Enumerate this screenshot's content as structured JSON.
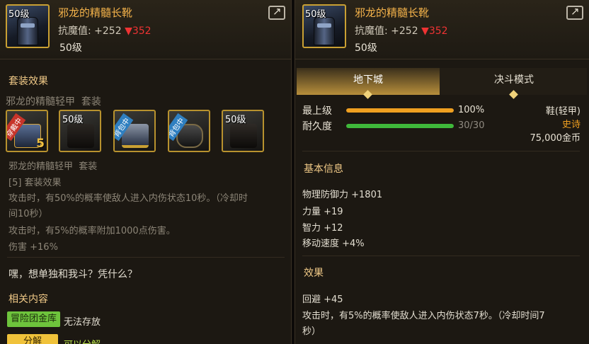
{
  "left": {
    "item": {
      "level_badge": "50级",
      "name": "邪龙的精髓长靴",
      "resist_label": "抗魔值: +252 ",
      "resist_down": "▼352",
      "level": "50级"
    },
    "set_effect_title": "套装效果",
    "set_name": "邪龙的精髓轻甲",
    "set_suffix": "套装",
    "slots": [
      {
        "tag": "穿戴中",
        "level": "",
        "num": "5"
      },
      {
        "tag": "",
        "level": "50级",
        "num": ""
      },
      {
        "tag": "背包中",
        "level": "",
        "num": ""
      },
      {
        "tag": "背包中",
        "level": "",
        "num": ""
      },
      {
        "tag": "",
        "level": "50级",
        "num": ""
      }
    ],
    "set_name2": "邪龙的精髓轻甲",
    "set_suffix2": "套装",
    "bonus_head": "[5] 套装效果",
    "bonus_line1": "攻击时，有50%的概率使敌人进入内伤状态10秒。（冷却时",
    "bonus_line1b": "间10秒）",
    "bonus_line2": "攻击时，有5%的概率附加1000点伤害。",
    "bonus_line3": "伤害 +16%",
    "flavor": "嘿，想单独和我斗？凭什么？",
    "related_title": "相关内容",
    "tag_bank": "冒险团金库",
    "tag_bank_value": "无法存放",
    "tag_disassemble": "分解",
    "tag_disassemble_value": "可以分解"
  },
  "right": {
    "item": {
      "level_badge": "50级",
      "name": "邪龙的精髓长靴",
      "resist_label": "抗魔值: +252 ",
      "resist_down": "▼352",
      "level": "50级"
    },
    "tabs": [
      "地下城",
      "决斗模式"
    ],
    "bars": [
      {
        "label": "最上级",
        "value": "100%",
        "fraction": 1.0,
        "color": "#f0a020"
      },
      {
        "label": "耐久度",
        "value": "30/30",
        "fraction": 1.0,
        "color": "#3fb83a"
      }
    ],
    "type": "鞋(轻甲)",
    "rarity": "史诗",
    "price": "75,000金币",
    "basic_title": "基本信息",
    "stats": [
      "物理防御力 +1801",
      "力量 +19",
      "智力 +12",
      "移动速度 +4%"
    ],
    "effect_title": "效果",
    "effects": [
      "回避 +45",
      "攻击时，有5%的概率使敌人进入内伤状态7秒。（冷却时间7",
      "秒）"
    ]
  },
  "colors": {
    "name": "#f3b24a",
    "accent": "#c9a033",
    "down": "#ee3333",
    "epic": "#f0a020",
    "green": "#6ec43c"
  }
}
